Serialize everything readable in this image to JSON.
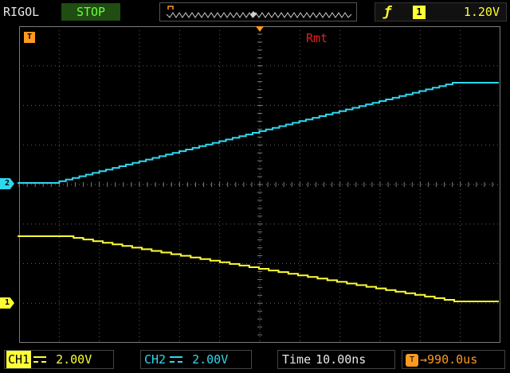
{
  "header": {
    "brand": "RIGOL",
    "run_state": "STOP",
    "trigger": {
      "slope_icon": "rising-edge-icon",
      "source": "1",
      "level": "1.20V"
    }
  },
  "screen": {
    "remote_label": "Rmt",
    "trigger_marker": "T",
    "ch1_ground_marker": "1",
    "ch2_ground_marker": "2"
  },
  "footer": {
    "ch1": {
      "tag": "CH1",
      "scale": "2.00V"
    },
    "ch2": {
      "tag": "CH2",
      "scale": "2.00V"
    },
    "time": {
      "label": "Time",
      "value": "10.00ns"
    },
    "offset": {
      "icon": "T",
      "value": "→990.0us"
    }
  },
  "colors": {
    "ch1": "#ffff33",
    "ch2": "#2ed8ee",
    "trigger": "#ff9a1f",
    "remote": "#e02020",
    "grid": "#7a7a7a"
  }
}
